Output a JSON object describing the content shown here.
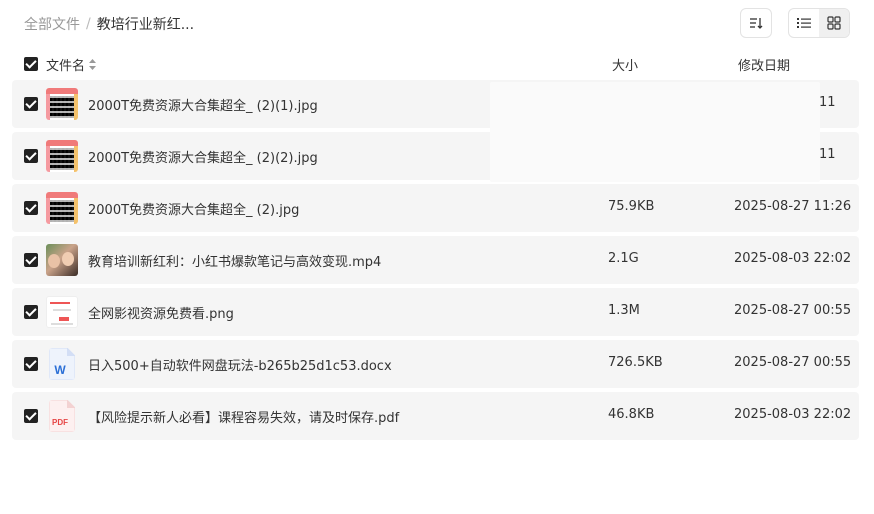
{
  "breadcrumb": {
    "root": "全部文件",
    "separator": "/",
    "current": "教培行业新红..."
  },
  "header": {
    "name_label": "文件名",
    "size_label": "大小",
    "date_label": "修改日期"
  },
  "toolbar": {
    "sort_icon": "sort-icon",
    "list_view_icon": "list-view-icon",
    "grid_view_icon": "grid-view-icon",
    "active_view": "list"
  },
  "files": [
    {
      "name": "2000T免费资源大合集超全_ (2)(1).jpg",
      "size": "",
      "date": "11",
      "thumb": "qr-image-icon",
      "checked": true
    },
    {
      "name": "2000T免费资源大合集超全_ (2)(2).jpg",
      "size": "",
      "date": "11",
      "thumb": "qr-image-icon",
      "checked": true
    },
    {
      "name": "2000T免费资源大合集超全_ (2).jpg",
      "size": "75.9KB",
      "date": "2025-08-27 11:26",
      "thumb": "qr-image-icon",
      "checked": true
    },
    {
      "name": "教育培训新红利：小红书爆款笔记与高效变现.mp4",
      "size": "2.1G",
      "date": "2025-08-03 22:02",
      "thumb": "video-thumbnail-icon",
      "checked": true
    },
    {
      "name": "全网影视资源免费看.png",
      "size": "1.3M",
      "date": "2025-08-27 00:55",
      "thumb": "png-image-icon",
      "checked": true
    },
    {
      "name": "日入500+自动软件网盘玩法-b265b25d1c53.docx",
      "size": "726.5KB",
      "date": "2025-08-27 00:55",
      "thumb": "word-doc-icon",
      "checked": true
    },
    {
      "name": "【风险提示新人必看】课程容易失效，请及时保存.pdf",
      "size": "46.8KB",
      "date": "2025-08-03 22:02",
      "thumb": "pdf-doc-icon",
      "checked": true
    }
  ],
  "icon_labels": {
    "word": "W",
    "pdf": "PDF"
  },
  "colors": {
    "row_bg": "#f5f5f5",
    "checkbox": "#222222",
    "word_blue": "#2b6fd6",
    "pdf_red": "#e64545"
  }
}
